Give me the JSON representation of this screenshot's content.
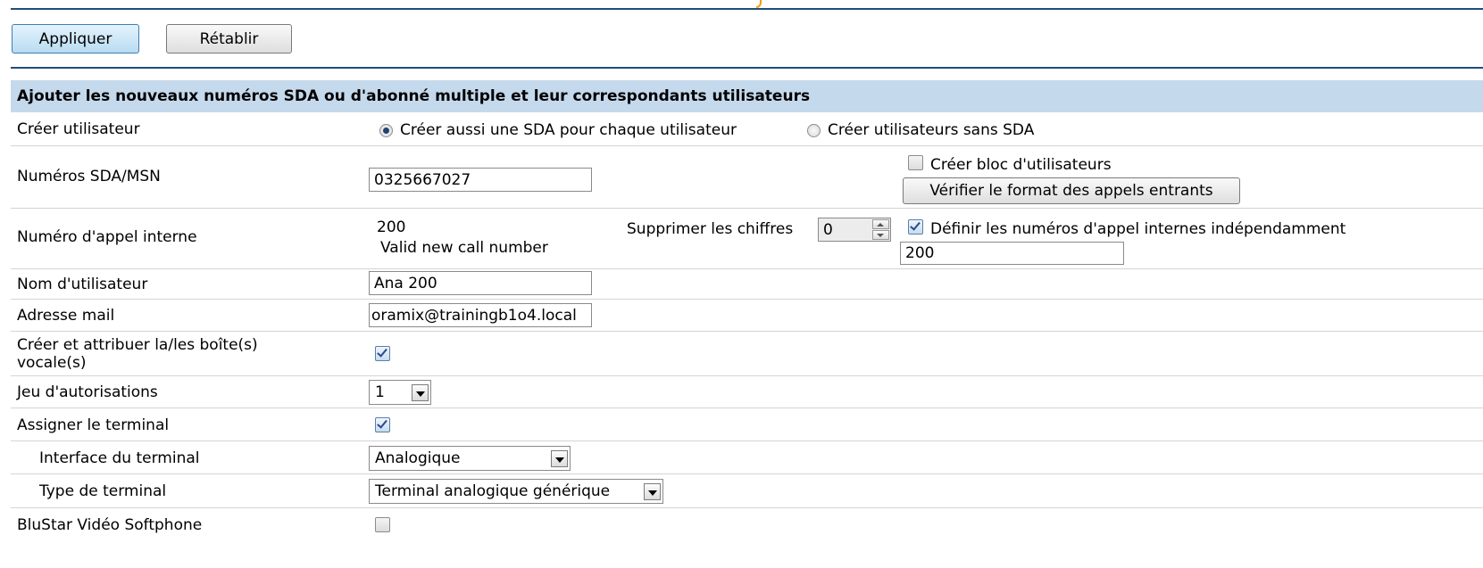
{
  "toolbar": {
    "apply_label": "Appliquer",
    "reset_label": "Rétablir"
  },
  "section": {
    "title": "Ajouter les nouveaux numéros SDA ou d'abonné multiple et leur correspondants utilisateurs"
  },
  "create_user": {
    "label": "Créer utilisateur",
    "option1": "Créer aussi une SDA pour chaque utilisateur",
    "option2": "Créer utilisateurs sans SDA",
    "selected": "option1"
  },
  "sda": {
    "label": "Numéros SDA/MSN",
    "value": "0325667027",
    "block_label": "Créer bloc d'utilisateurs",
    "block_checked": false,
    "verify_label": "Vérifier le format des appels entrants"
  },
  "internal_number": {
    "label": "Numéro d'appel interne",
    "value": "200",
    "status": "Valid new call number",
    "strip_label": "Supprimer les chiffres",
    "strip_value": "0",
    "define_label": "Définir les numéros d'appel internes indépendamment",
    "define_checked": true,
    "define_value": "200"
  },
  "username": {
    "label": "Nom d'utilisateur",
    "value": "Ana 200"
  },
  "email": {
    "label": "Adresse mail",
    "value": "oramix@trainingb1o4.local"
  },
  "voicemail": {
    "label": "Créer et attribuer la/les boîte(s) vocale(s)",
    "checked": true
  },
  "auth_set": {
    "label": "Jeu d'autorisations",
    "value": "1"
  },
  "assign_terminal": {
    "label": "Assigner le terminal",
    "checked": true
  },
  "terminal_interface": {
    "label": "Interface du terminal",
    "value": "Analogique"
  },
  "terminal_type": {
    "label": "Type de terminal",
    "value": "Terminal analogique générique"
  },
  "bluestar": {
    "label": "BluStar Vidéo Softphone",
    "checked": false
  }
}
